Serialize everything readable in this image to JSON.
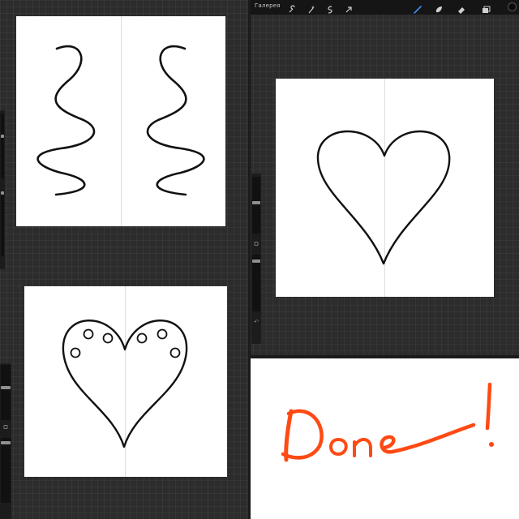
{
  "toolbar": {
    "gallery_label": "Галерея",
    "icons": [
      "wrench-icon",
      "magic-wand-icon",
      "selection-icon",
      "transform-arrow-icon",
      "brush-icon",
      "smudge-icon",
      "eraser-icon",
      "layers-icon"
    ],
    "active_tool": "brush-icon",
    "accent_color": "#3f8ef5",
    "current_color": "#0c0c0c"
  },
  "panels": {
    "top_left": {
      "content": "mirrored-waves-drawing"
    },
    "top_right": {
      "content": "heart-outline-drawing"
    },
    "bottom_left": {
      "content": "heart-with-circles-drawing"
    },
    "bottom_right": {
      "content": "done-lettering",
      "ink_color": "#ff4a14"
    }
  },
  "colors": {
    "ink": "#111111",
    "app_background": "#2c2c2c",
    "toolbar_background": "#151515"
  }
}
